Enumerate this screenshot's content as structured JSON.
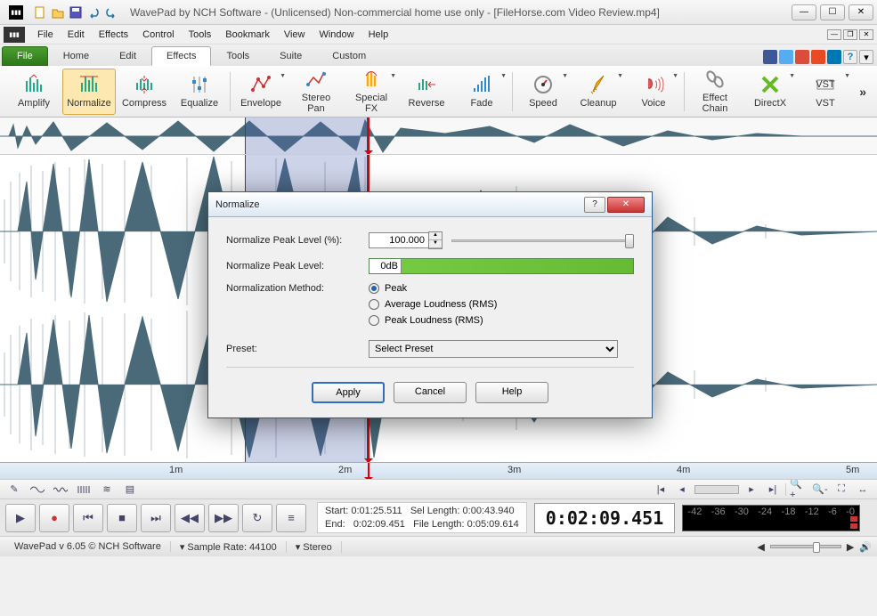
{
  "titlebar": {
    "title": "WavePad by NCH Software - (Unlicensed) Non-commercial home use only - [FileHorse.com Video Review.mp4]"
  },
  "menubar": {
    "items": [
      "File",
      "Edit",
      "Effects",
      "Control",
      "Tools",
      "Bookmark",
      "View",
      "Window",
      "Help"
    ]
  },
  "tabs": {
    "file": "File",
    "items": [
      "Home",
      "Edit",
      "Effects",
      "Tools",
      "Suite",
      "Custom"
    ],
    "active": "Effects"
  },
  "ribbon": {
    "buttons": [
      "Amplify",
      "Normalize",
      "Compress",
      "Equalize",
      "Envelope",
      "Stereo Pan",
      "Special FX",
      "Reverse",
      "Fade",
      "Speed",
      "Cleanup",
      "Voice",
      "Effect Chain",
      "DirectX",
      "VST"
    ],
    "active": "Normalize"
  },
  "ruler": {
    "marks": [
      "1m",
      "2m",
      "3m",
      "4m",
      "5m"
    ]
  },
  "dialog": {
    "title": "Normalize",
    "peak_pct_label": "Normalize Peak Level (%):",
    "peak_pct_value": "100.000",
    "peak_db_label": "Normalize Peak Level:",
    "peak_db_value": "0dB",
    "method_label": "Normalization Method:",
    "method_options": [
      "Peak",
      "Average Loudness (RMS)",
      "Peak Loudness (RMS)"
    ],
    "method_selected": "Peak",
    "preset_label": "Preset:",
    "preset_value": "Select Preset",
    "btn_apply": "Apply",
    "btn_cancel": "Cancel",
    "btn_help": "Help"
  },
  "transport": {
    "start_label": "Start:",
    "start_val": "0:01:25.511",
    "end_label": "End:",
    "end_val": "0:02:09.451",
    "sellen_label": "Sel Length:",
    "sellen_val": "0:00:43.940",
    "filelen_label": "File Length:",
    "filelen_val": "0:05:09.614",
    "bigtime": "0:02:09.451",
    "meter_scale": [
      "-42",
      "-36",
      "-30",
      "-24",
      "-18",
      "-12",
      "-6",
      "-0"
    ]
  },
  "status": {
    "app": "WavePad v 6.05 © NCH Software",
    "rate_label": "Sample Rate:",
    "rate_val": "44100",
    "channels": "Stereo"
  }
}
